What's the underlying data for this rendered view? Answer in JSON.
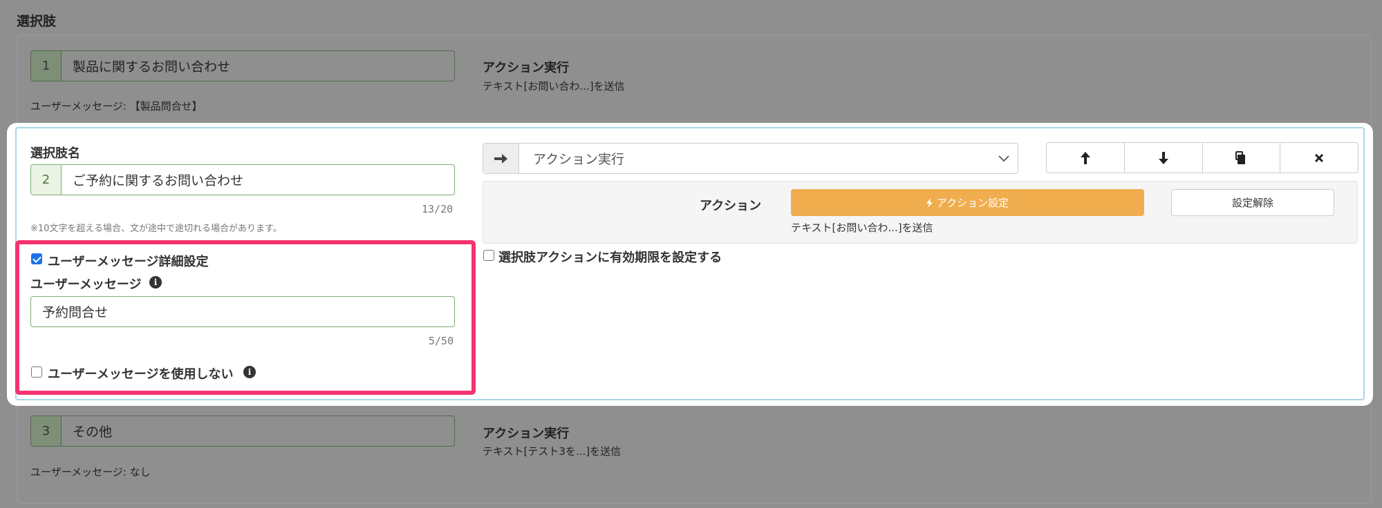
{
  "section_title": "選択肢",
  "items": [
    {
      "number": "1",
      "name": "製品に関するお問い合わせ",
      "action_title": "アクション実行",
      "action_desc": "テキスト[お問い合わ...]を送信",
      "user_message": "ユーザーメッセージ: 【製品問合せ】"
    },
    {
      "number": "3",
      "name": "その他",
      "action_title": "アクション実行",
      "action_desc": "テキスト[テスト3を...]を送信",
      "user_message": "ユーザーメッセージ: なし"
    }
  ],
  "editor": {
    "name_label": "選択肢名",
    "number": "2",
    "name_value": "ご予約に関するお問い合わせ",
    "name_counter": "13/20",
    "name_note": "※10文字を超える場合、文が途中で途切れる場合があります。",
    "detail_checkbox_label": "ユーザーメッセージ詳細設定",
    "detail_checked": true,
    "user_message_label": "ユーザーメッセージ",
    "user_message_value": "予約問合せ",
    "user_message_counter": "5/50",
    "no_user_message_label": "ユーザーメッセージを使用しない",
    "no_user_message_checked": false,
    "action_type_selected": "アクション実行",
    "action_label": "アクション",
    "action_button": "アクション設定",
    "reset_button": "設定解除",
    "action_desc": "テキスト[お問い合わ...]を送信",
    "expire_label": "選択肢アクションに有効期限を設定する",
    "buttons": {
      "up_icon": "arrow-up-icon",
      "down_icon": "arrow-down-icon",
      "copy_icon": "copy-icon",
      "delete_icon": "close-icon"
    }
  },
  "colors": {
    "highlight": "#f5346f",
    "action_button": "#f0ad4e",
    "active_border": "#7cae72",
    "card_border": "#a9d6ea"
  }
}
